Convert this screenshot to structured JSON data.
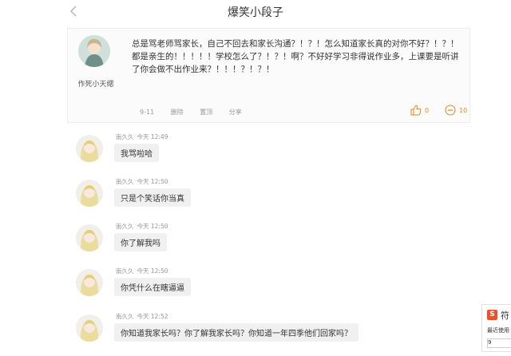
{
  "header": {
    "title": "爆笑小段子",
    "back_icon": "chevron-left-icon"
  },
  "post": {
    "author": "作死小天缌",
    "content": "总是骂老师骂家长，自己不回去和家长沟通？！？！怎么知道家长真的对你不好？！？！都是亲生的！！！！！学校怎么了？！？！啊？不好好学习非得说作业多，上课要是听讲了你会做不出作业来？！！！？！？！",
    "date": "9-11",
    "actions": [
      "删除",
      "置顶",
      "分享"
    ],
    "likes": "0",
    "dislikes": "10",
    "accent_color": "#e08a20"
  },
  "messages": [
    {
      "author": "南久久",
      "time": "今天 12:49",
      "text": "我骂啦哈"
    },
    {
      "author": "南久久",
      "time": "今天 12:50",
      "text": "只是个笑话你当真"
    },
    {
      "author": "南久久",
      "time": "今天 12:50",
      "text": "你了解我吗"
    },
    {
      "author": "南久久",
      "time": "今天 12:50",
      "text": "你凭什么在瞎逼逼"
    },
    {
      "author": "南久久",
      "time": "今天 12:52",
      "text": "你知道我家长吗？你了解我家长吗？你知道一年四季他们回家吗？"
    }
  ],
  "side_widget": {
    "logo": "S",
    "title": "符",
    "subtitle": "最近使用",
    "cell": "9"
  }
}
